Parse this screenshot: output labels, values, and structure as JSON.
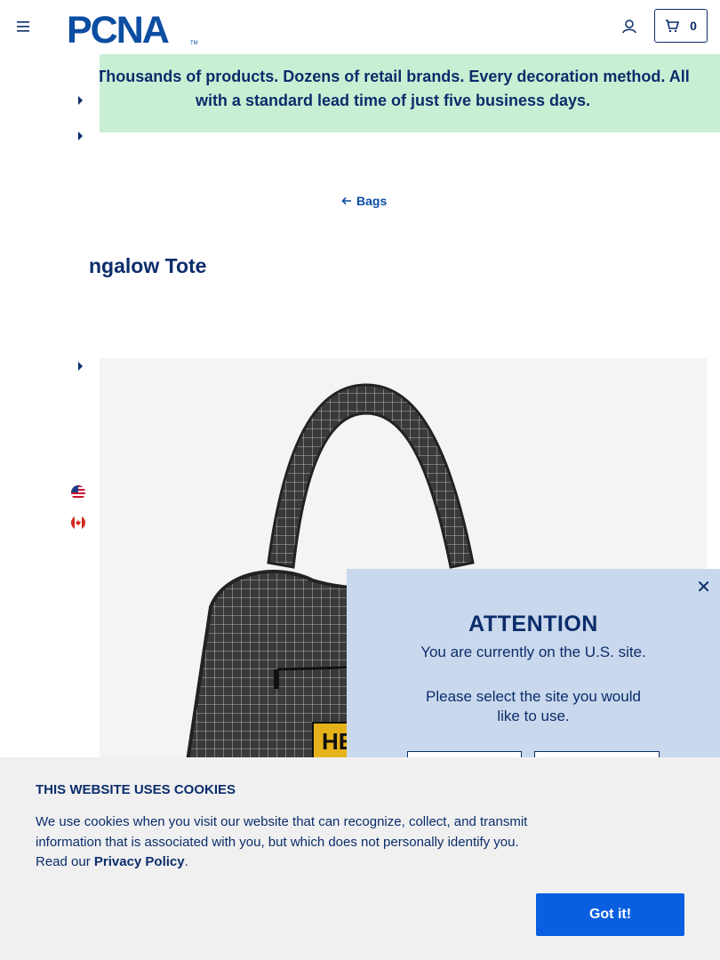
{
  "header": {
    "brand": "PCNA",
    "brand_tm": "TM",
    "cart_count": "0"
  },
  "banner": {
    "text": "Thousands of products. Dozens of retail brands. Every decoration method. All with a standard lead time of just five business days."
  },
  "breadcrumb": {
    "back_label": "Bags"
  },
  "product": {
    "title_visible": "ngalow Tote"
  },
  "attention": {
    "heading": "ATTENTION",
    "message": "You are currently on the U.S. site.",
    "prompt": "Please select the site you would like to use.",
    "close_glyph": "✕"
  },
  "cookie": {
    "title": "THIS WEBSITE USES COOKIES",
    "body": "We use cookies when you visit our website that can recognize, collect, and transmit information that is associated with you, but which does not personally identify you. Read our ",
    "link": "Privacy Policy",
    "period": ".",
    "accept": "Got it!"
  },
  "colors": {
    "navy": "#0b2d6b",
    "banner_bg": "#c8efd4",
    "modal_bg": "#c9d8ec",
    "cookie_bg": "#f0f0f0",
    "accept_btn": "#0a5fe0"
  }
}
